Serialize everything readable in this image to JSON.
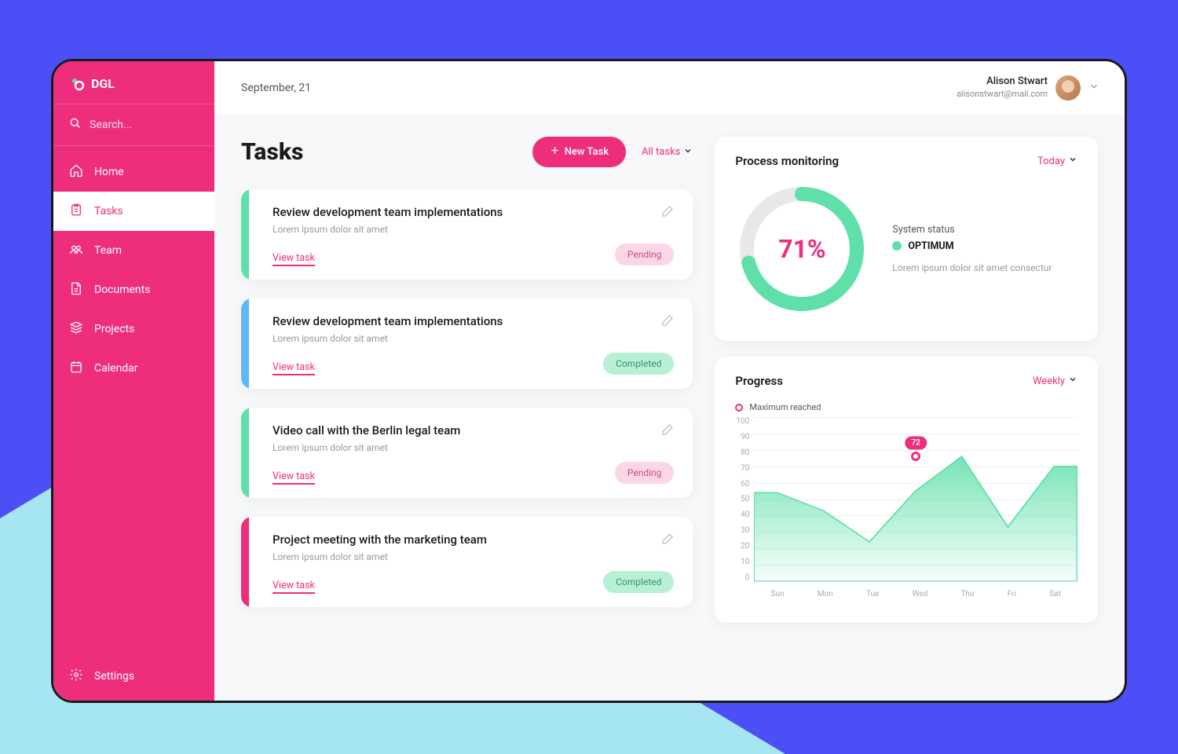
{
  "brand": "DGL",
  "search": {
    "placeholder": "Search..."
  },
  "sidebar": {
    "items": [
      {
        "label": "Home"
      },
      {
        "label": "Tasks"
      },
      {
        "label": "Team"
      },
      {
        "label": "Documents"
      },
      {
        "label": "Projects"
      },
      {
        "label": "Calendar"
      }
    ],
    "settings": "Settings"
  },
  "topbar": {
    "date": "September, 21",
    "user_name": "Alison Stwart",
    "user_email": "alisonstwart@mail.com"
  },
  "page": {
    "title": "Tasks",
    "new_task_label": "New Task",
    "filter_label": "All tasks"
  },
  "tasks": [
    {
      "title": "Review development team implementations",
      "subtitle": "Lorem ipsum dolor sit amet",
      "view": "View task",
      "status": "Pending",
      "accent": "green"
    },
    {
      "title": "Review development team implementations",
      "subtitle": "Lorem ipsum dolor sit amet",
      "view": "View task",
      "status": "Completed",
      "accent": "blue"
    },
    {
      "title": "Video call with the Berlin legal team",
      "subtitle": "Lorem ipsum dolor sit amet",
      "view": "View task",
      "status": "Pending",
      "accent": "green"
    },
    {
      "title": "Project meeting with the marketing team",
      "subtitle": "Lorem ipsum dolor sit amet",
      "view": "View task",
      "status": "Completed",
      "accent": "pink"
    }
  ],
  "monitor": {
    "title": "Process monitoring",
    "filter": "Today",
    "percent": "71%",
    "status_label": "System status",
    "status_value": "OPTIMUM",
    "status_desc": "Lorem ipsum dolor sit amet consectur"
  },
  "progress": {
    "title": "Progress",
    "filter": "Weekly",
    "legend": "Maximum reached",
    "marker_value": "72"
  },
  "chart_data": {
    "type": "area",
    "categories": [
      "Sun",
      "Mon",
      "Tue",
      "Wed",
      "Thu",
      "Fri",
      "Sat"
    ],
    "values": [
      54,
      43,
      24,
      55,
      76,
      33,
      70
    ],
    "ylim": [
      0,
      100
    ],
    "yticks": [
      0,
      10,
      20,
      30,
      40,
      50,
      60,
      70,
      80,
      90,
      100
    ],
    "marker": {
      "category": "Wed",
      "value": 76,
      "label": "72"
    },
    "xlabel": "",
    "ylabel": "",
    "title": ""
  },
  "colors": {
    "accent": "#ee2e7c",
    "success": "#5ee0a8"
  }
}
